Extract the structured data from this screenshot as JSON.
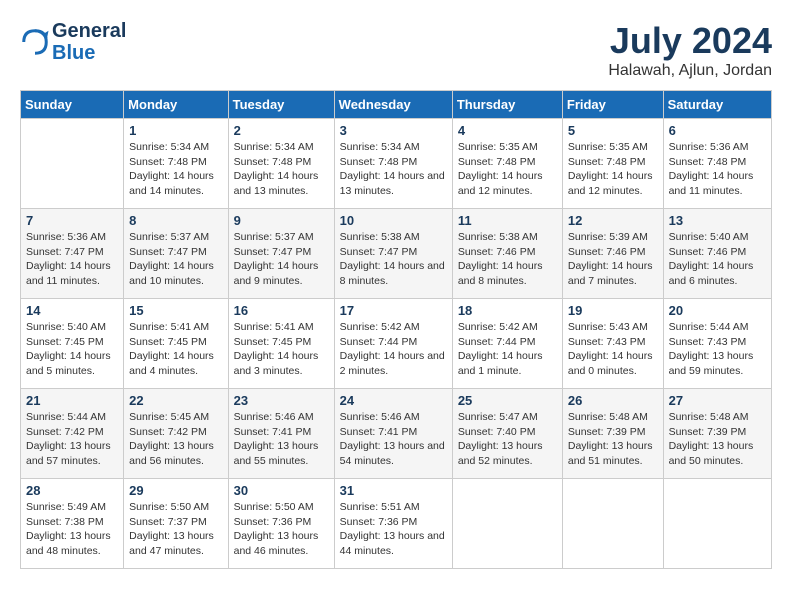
{
  "header": {
    "logo_line1": "General",
    "logo_line2": "Blue",
    "month": "July 2024",
    "location": "Halawah, Ajlun, Jordan"
  },
  "days_of_week": [
    "Sunday",
    "Monday",
    "Tuesday",
    "Wednesday",
    "Thursday",
    "Friday",
    "Saturday"
  ],
  "weeks": [
    [
      {
        "day": "",
        "sunrise": "",
        "sunset": "",
        "daylight": ""
      },
      {
        "day": "1",
        "sunrise": "Sunrise: 5:34 AM",
        "sunset": "Sunset: 7:48 PM",
        "daylight": "Daylight: 14 hours and 14 minutes."
      },
      {
        "day": "2",
        "sunrise": "Sunrise: 5:34 AM",
        "sunset": "Sunset: 7:48 PM",
        "daylight": "Daylight: 14 hours and 13 minutes."
      },
      {
        "day": "3",
        "sunrise": "Sunrise: 5:34 AM",
        "sunset": "Sunset: 7:48 PM",
        "daylight": "Daylight: 14 hours and 13 minutes."
      },
      {
        "day": "4",
        "sunrise": "Sunrise: 5:35 AM",
        "sunset": "Sunset: 7:48 PM",
        "daylight": "Daylight: 14 hours and 12 minutes."
      },
      {
        "day": "5",
        "sunrise": "Sunrise: 5:35 AM",
        "sunset": "Sunset: 7:48 PM",
        "daylight": "Daylight: 14 hours and 12 minutes."
      },
      {
        "day": "6",
        "sunrise": "Sunrise: 5:36 AM",
        "sunset": "Sunset: 7:48 PM",
        "daylight": "Daylight: 14 hours and 11 minutes."
      }
    ],
    [
      {
        "day": "7",
        "sunrise": "Sunrise: 5:36 AM",
        "sunset": "Sunset: 7:47 PM",
        "daylight": "Daylight: 14 hours and 11 minutes."
      },
      {
        "day": "8",
        "sunrise": "Sunrise: 5:37 AM",
        "sunset": "Sunset: 7:47 PM",
        "daylight": "Daylight: 14 hours and 10 minutes."
      },
      {
        "day": "9",
        "sunrise": "Sunrise: 5:37 AM",
        "sunset": "Sunset: 7:47 PM",
        "daylight": "Daylight: 14 hours and 9 minutes."
      },
      {
        "day": "10",
        "sunrise": "Sunrise: 5:38 AM",
        "sunset": "Sunset: 7:47 PM",
        "daylight": "Daylight: 14 hours and 8 minutes."
      },
      {
        "day": "11",
        "sunrise": "Sunrise: 5:38 AM",
        "sunset": "Sunset: 7:46 PM",
        "daylight": "Daylight: 14 hours and 8 minutes."
      },
      {
        "day": "12",
        "sunrise": "Sunrise: 5:39 AM",
        "sunset": "Sunset: 7:46 PM",
        "daylight": "Daylight: 14 hours and 7 minutes."
      },
      {
        "day": "13",
        "sunrise": "Sunrise: 5:40 AM",
        "sunset": "Sunset: 7:46 PM",
        "daylight": "Daylight: 14 hours and 6 minutes."
      }
    ],
    [
      {
        "day": "14",
        "sunrise": "Sunrise: 5:40 AM",
        "sunset": "Sunset: 7:45 PM",
        "daylight": "Daylight: 14 hours and 5 minutes."
      },
      {
        "day": "15",
        "sunrise": "Sunrise: 5:41 AM",
        "sunset": "Sunset: 7:45 PM",
        "daylight": "Daylight: 14 hours and 4 minutes."
      },
      {
        "day": "16",
        "sunrise": "Sunrise: 5:41 AM",
        "sunset": "Sunset: 7:45 PM",
        "daylight": "Daylight: 14 hours and 3 minutes."
      },
      {
        "day": "17",
        "sunrise": "Sunrise: 5:42 AM",
        "sunset": "Sunset: 7:44 PM",
        "daylight": "Daylight: 14 hours and 2 minutes."
      },
      {
        "day": "18",
        "sunrise": "Sunrise: 5:42 AM",
        "sunset": "Sunset: 7:44 PM",
        "daylight": "Daylight: 14 hours and 1 minute."
      },
      {
        "day": "19",
        "sunrise": "Sunrise: 5:43 AM",
        "sunset": "Sunset: 7:43 PM",
        "daylight": "Daylight: 14 hours and 0 minutes."
      },
      {
        "day": "20",
        "sunrise": "Sunrise: 5:44 AM",
        "sunset": "Sunset: 7:43 PM",
        "daylight": "Daylight: 13 hours and 59 minutes."
      }
    ],
    [
      {
        "day": "21",
        "sunrise": "Sunrise: 5:44 AM",
        "sunset": "Sunset: 7:42 PM",
        "daylight": "Daylight: 13 hours and 57 minutes."
      },
      {
        "day": "22",
        "sunrise": "Sunrise: 5:45 AM",
        "sunset": "Sunset: 7:42 PM",
        "daylight": "Daylight: 13 hours and 56 minutes."
      },
      {
        "day": "23",
        "sunrise": "Sunrise: 5:46 AM",
        "sunset": "Sunset: 7:41 PM",
        "daylight": "Daylight: 13 hours and 55 minutes."
      },
      {
        "day": "24",
        "sunrise": "Sunrise: 5:46 AM",
        "sunset": "Sunset: 7:41 PM",
        "daylight": "Daylight: 13 hours and 54 minutes."
      },
      {
        "day": "25",
        "sunrise": "Sunrise: 5:47 AM",
        "sunset": "Sunset: 7:40 PM",
        "daylight": "Daylight: 13 hours and 52 minutes."
      },
      {
        "day": "26",
        "sunrise": "Sunrise: 5:48 AM",
        "sunset": "Sunset: 7:39 PM",
        "daylight": "Daylight: 13 hours and 51 minutes."
      },
      {
        "day": "27",
        "sunrise": "Sunrise: 5:48 AM",
        "sunset": "Sunset: 7:39 PM",
        "daylight": "Daylight: 13 hours and 50 minutes."
      }
    ],
    [
      {
        "day": "28",
        "sunrise": "Sunrise: 5:49 AM",
        "sunset": "Sunset: 7:38 PM",
        "daylight": "Daylight: 13 hours and 48 minutes."
      },
      {
        "day": "29",
        "sunrise": "Sunrise: 5:50 AM",
        "sunset": "Sunset: 7:37 PM",
        "daylight": "Daylight: 13 hours and 47 minutes."
      },
      {
        "day": "30",
        "sunrise": "Sunrise: 5:50 AM",
        "sunset": "Sunset: 7:36 PM",
        "daylight": "Daylight: 13 hours and 46 minutes."
      },
      {
        "day": "31",
        "sunrise": "Sunrise: 5:51 AM",
        "sunset": "Sunset: 7:36 PM",
        "daylight": "Daylight: 13 hours and 44 minutes."
      },
      {
        "day": "",
        "sunrise": "",
        "sunset": "",
        "daylight": ""
      },
      {
        "day": "",
        "sunrise": "",
        "sunset": "",
        "daylight": ""
      },
      {
        "day": "",
        "sunrise": "",
        "sunset": "",
        "daylight": ""
      }
    ]
  ]
}
